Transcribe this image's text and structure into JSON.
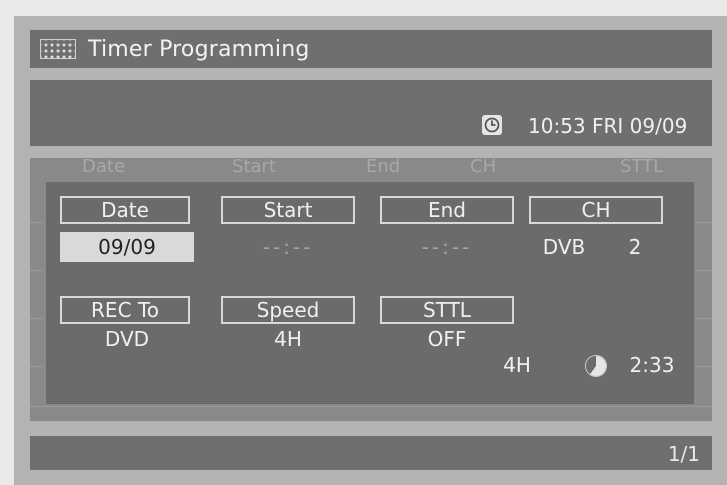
{
  "window": {
    "title": "Timer Programming"
  },
  "clock": {
    "time_text": "10:53 FRI 09/09"
  },
  "list_header": {
    "date": "Date",
    "start": "Start",
    "end": "End",
    "ch": "CH",
    "sttl": "STTL"
  },
  "dialog": {
    "fields": {
      "date": {
        "label": "Date",
        "value": "09/09"
      },
      "start": {
        "label": "Start",
        "value": "--:--"
      },
      "end": {
        "label": "End",
        "value": "--:--"
      },
      "ch": {
        "label": "CH",
        "value_type": "DVB",
        "value_num": "2"
      },
      "rec_to": {
        "label": "REC To",
        "value": "DVD"
      },
      "speed": {
        "label": "Speed",
        "value": "4H"
      },
      "sttl": {
        "label": "STTL",
        "value": "OFF"
      }
    },
    "remaining": {
      "mode": "4H",
      "time": "2:33",
      "disc_used_fraction": 0.6
    }
  },
  "footer": {
    "page": "1/1"
  },
  "colors": {
    "panel": "#6f6f6f",
    "screen": "#b3b3b3",
    "selected": "#d9d9d9"
  }
}
